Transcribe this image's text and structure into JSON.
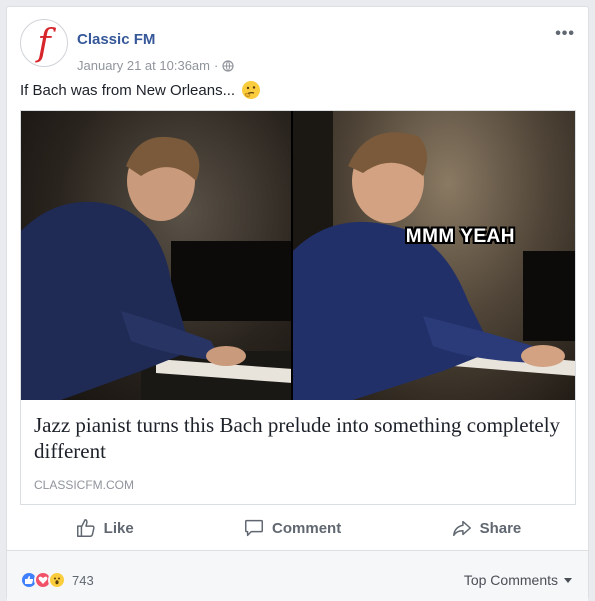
{
  "post": {
    "page_name": "Classic FM",
    "timestamp": "January 21 at 10:36am",
    "separator": "·",
    "caption": "If Bach was from New Orleans...",
    "more_label": "•••"
  },
  "link": {
    "meme_text": "MMM YEAH",
    "title": "Jazz pianist turns this Bach prelude into something completely different",
    "domain": "CLASSICFM.COM"
  },
  "actions": {
    "like": "Like",
    "comment": "Comment",
    "share": "Share"
  },
  "footer": {
    "reaction_count": "743",
    "sort_label": "Top Comments"
  },
  "colors": {
    "link_blue": "#365899",
    "like_blue": "#4080ff",
    "love_red": "#f25268",
    "wow_yellow": "#fbcd3c"
  }
}
